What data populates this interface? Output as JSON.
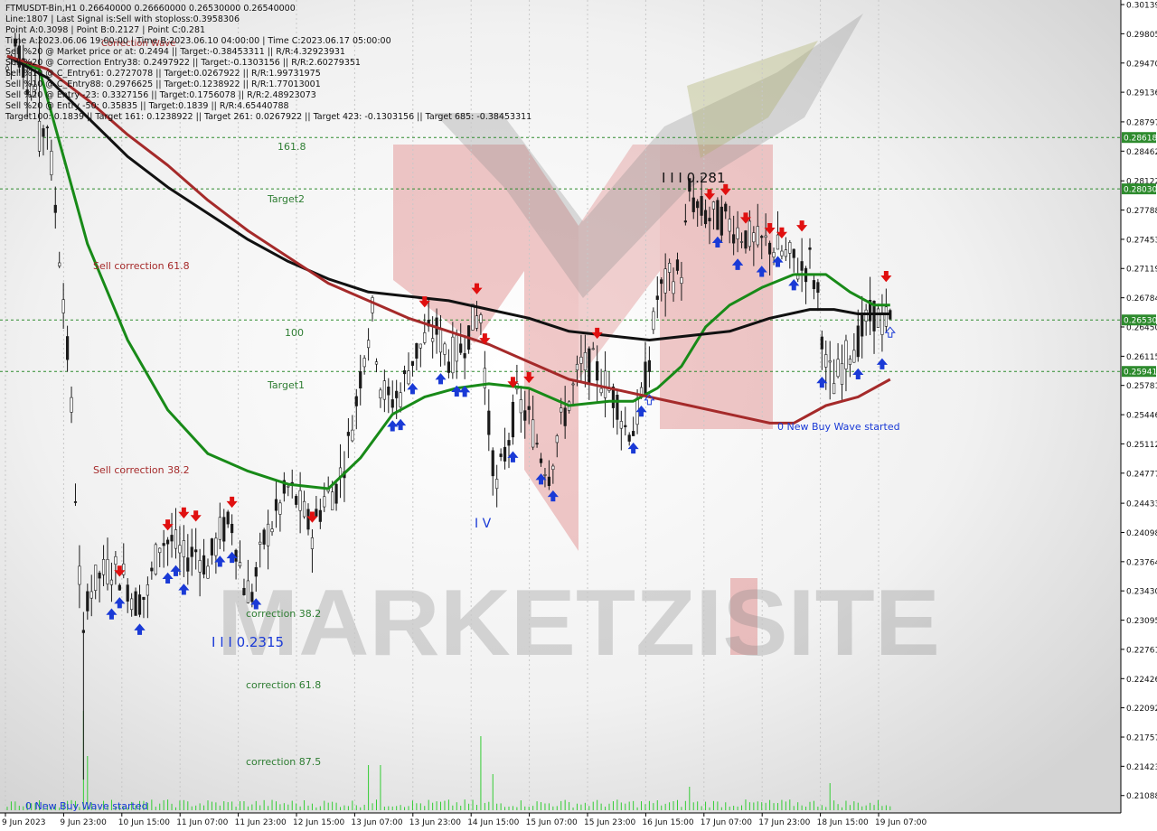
{
  "header": {
    "lines": [
      "FTMUSDT-Bin,H1  0.26640000 0.26660000 0.26530000 0.26540000",
      "Line:1807 | Last Signal is:Sell with stoploss:0.3958306",
      "Point A:0.3098 | Point B:0.2127 | Point C:0.281",
      "Time A:2023.06.06 19:00:00 | Time B:2023.06.10 04:00:00 | Time C:2023.06.17 05:00:00",
      "Sell %20 @ Market price or at: 0.2494 || Target:-0.38453311 || R/R:4.32923931",
      "Sell %20 @ Correction Entry38: 0.2497922 || Target:-0.1303156 || R/R:2.60279351",
      "Sell %10 @ C_Entry61: 0.2727078 || Target:0.0267922 || R/R:1.99731975",
      "Sell %10 @ C_Entry88: 0.2976625 || Target:0.1238922 || R/R:1.77013001",
      "Sell %20 @ Entry -23: 0.3327156 || Target:0.1756078 || R/R:2.48923073",
      "Sell %20 @ Entry -50: 0.35835 || Target:0.1839 || R/R:4.65440788",
      "Target100: 0.1839 || Target 161: 0.1238922 || Target 261: 0.0267922 || Target 423: -0.1303156 || Target 685: -0.38453311"
    ]
  },
  "price_axis": {
    "ticks": [
      "0.30139",
      "0.29805",
      "0.29470",
      "0.29136",
      "0.28797",
      "0.28462",
      "0.28122",
      "0.27788",
      "0.27453",
      "0.27119",
      "0.26784",
      "0.26450",
      "0.26115",
      "0.25781",
      "0.25446",
      "0.25112",
      "0.24777",
      "0.24433",
      "0.24098",
      "0.23764",
      "0.23430",
      "0.23095",
      "0.22761",
      "0.22426",
      "0.22092",
      "0.21757",
      "0.21423",
      "0.21088"
    ],
    "markers": [
      {
        "label": "0.28618",
        "color": "#2e8b2e"
      },
      {
        "label": "0.28030",
        "color": "#2e8b2e"
      },
      {
        "label": "0.26530",
        "color": "#2e8b2e"
      },
      {
        "label": "0.25941",
        "color": "#2e8b2e"
      }
    ]
  },
  "time_axis": {
    "labels": [
      "9 Jun 2023",
      "9 Jun 23:00",
      "10 Jun 15:00",
      "11 Jun 07:00",
      "11 Jun 23:00",
      "12 Jun 15:00",
      "13 Jun 07:00",
      "13 Jun 23:00",
      "14 Jun 15:00",
      "15 Jun 07:00",
      "15 Jun 23:00",
      "16 Jun 15:00",
      "17 Jun 07:00",
      "17 Jun 23:00",
      "18 Jun 15:00",
      "19 Jun 07:00"
    ]
  },
  "levels": [
    {
      "label": "161.8",
      "color": "#2e7d32"
    },
    {
      "label": "Target2",
      "color": "#2e7d32"
    },
    {
      "label": "100",
      "color": "#2e7d32"
    },
    {
      "label": "Target1",
      "color": "#2e7d32"
    }
  ],
  "annotations": {
    "sell_correction_618": "Sell correction 61.8",
    "sell_correction_382": "Sell correction 38.2",
    "correction_382": "correction 38.2",
    "correction_618": "correction 61.8",
    "correction_875": "correction 87.5",
    "wave_low": "I I I 0.2315",
    "wave_high": "I I I 0.281",
    "wave_iv": "I V",
    "new_buy_wave_1": "0 New Buy Wave started",
    "new_buy_wave_2": "0 New Buy Wave started",
    "correction_overlay": "Correction Wave"
  },
  "watermark": {
    "text": "MARKETZISITE"
  },
  "colors": {
    "green_ma": "#188a18",
    "black_ma": "#111111",
    "red_ma": "#a52a2a",
    "buy_arrow": "#1a3ad6",
    "sell_arrow": "#e01010",
    "level_line": "#2e8b2e",
    "label_marker_bg": "#2e8b2e"
  },
  "chart_data": {
    "type": "candlestick",
    "symbol": "FTMUSDT-Bin",
    "timeframe": "H1",
    "ohlc_last": {
      "open": 0.2664,
      "high": 0.2666,
      "low": 0.2653,
      "close": 0.2654
    },
    "ylim": [
      0.2092,
      0.3015
    ],
    "x_range": [
      "2023-06-09 07:00",
      "2023-06-19 16:00"
    ],
    "horizontal_levels": [
      0.28618,
      0.2803,
      0.2653,
      0.25941
    ],
    "price_path": [
      [
        0,
        0.294
      ],
      [
        2,
        0.297
      ],
      [
        3,
        0.296
      ],
      [
        5,
        0.293
      ],
      [
        7,
        0.292
      ],
      [
        8,
        0.286
      ],
      [
        10,
        0.288
      ],
      [
        12,
        0.278
      ],
      [
        14,
        0.268
      ],
      [
        16,
        0.255
      ],
      [
        18,
        0.236
      ],
      [
        19,
        0.228
      ],
      [
        20,
        0.234
      ],
      [
        23,
        0.236
      ],
      [
        26,
        0.237
      ],
      [
        29,
        0.236
      ],
      [
        32,
        0.233
      ],
      [
        35,
        0.234
      ],
      [
        38,
        0.24
      ],
      [
        41,
        0.24
      ],
      [
        44,
        0.238
      ],
      [
        47,
        0.239
      ],
      [
        50,
        0.237
      ],
      [
        53,
        0.241
      ],
      [
        56,
        0.242
      ],
      [
        59,
        0.235
      ],
      [
        61,
        0.234
      ],
      [
        64,
        0.24
      ],
      [
        67,
        0.243
      ],
      [
        70,
        0.246
      ],
      [
        73,
        0.244
      ],
      [
        76,
        0.241
      ],
      [
        79,
        0.245
      ],
      [
        82,
        0.246
      ],
      [
        85,
        0.251
      ],
      [
        87,
        0.256
      ],
      [
        89,
        0.262
      ],
      [
        91,
        0.266
      ],
      [
        93,
        0.258
      ],
      [
        95,
        0.256
      ],
      [
        98,
        0.257
      ],
      [
        101,
        0.261
      ],
      [
        104,
        0.263
      ],
      [
        107,
        0.264
      ],
      [
        110,
        0.261
      ],
      [
        113,
        0.262
      ],
      [
        116,
        0.265
      ],
      [
        118,
        0.266
      ],
      [
        120,
        0.253
      ],
      [
        122,
        0.246
      ],
      [
        124,
        0.25
      ],
      [
        127,
        0.256
      ],
      [
        130,
        0.254
      ],
      [
        133,
        0.25
      ],
      [
        135,
        0.248
      ],
      [
        137,
        0.252
      ],
      [
        140,
        0.256
      ],
      [
        143,
        0.26
      ],
      [
        146,
        0.26
      ],
      [
        149,
        0.258
      ],
      [
        152,
        0.256
      ],
      [
        154,
        0.253
      ],
      [
        156,
        0.253
      ],
      [
        158,
        0.256
      ],
      [
        160,
        0.261
      ],
      [
        162,
        0.268
      ],
      [
        165,
        0.27
      ],
      [
        168,
        0.271
      ],
      [
        170,
        0.28
      ],
      [
        172,
        0.278
      ],
      [
        175,
        0.277
      ],
      [
        178,
        0.277
      ],
      [
        181,
        0.276
      ],
      [
        184,
        0.275
      ],
      [
        187,
        0.274
      ],
      [
        190,
        0.274
      ],
      [
        193,
        0.273
      ],
      [
        196,
        0.272
      ],
      [
        198,
        0.271
      ],
      [
        200,
        0.272
      ],
      [
        202,
        0.268
      ],
      [
        204,
        0.26
      ],
      [
        206,
        0.258
      ],
      [
        208,
        0.26
      ],
      [
        210,
        0.262
      ],
      [
        212,
        0.263
      ],
      [
        214,
        0.265
      ],
      [
        216,
        0.266
      ],
      [
        218,
        0.265
      ],
      [
        220,
        0.2654
      ]
    ],
    "series": [
      {
        "name": "",
        "color": "#188a18",
        "values": [
          [
            0,
            0.2955
          ],
          [
            8,
            0.294
          ],
          [
            14,
            0.284
          ],
          [
            20,
            0.274
          ],
          [
            30,
            0.263
          ],
          [
            40,
            0.255
          ],
          [
            50,
            0.25
          ],
          [
            60,
            0.248
          ],
          [
            70,
            0.2465
          ],
          [
            80,
            0.246
          ],
          [
            88,
            0.2495
          ],
          [
            96,
            0.2545
          ],
          [
            104,
            0.2565
          ],
          [
            112,
            0.2575
          ],
          [
            120,
            0.258
          ],
          [
            130,
            0.2575
          ],
          [
            140,
            0.2555
          ],
          [
            150,
            0.256
          ],
          [
            156,
            0.256
          ],
          [
            162,
            0.2575
          ],
          [
            168,
            0.26
          ],
          [
            174,
            0.2645
          ],
          [
            180,
            0.267
          ],
          [
            188,
            0.269
          ],
          [
            196,
            0.2705
          ],
          [
            204,
            0.2705
          ],
          [
            210,
            0.2685
          ],
          [
            216,
            0.267
          ],
          [
            220,
            0.267
          ]
        ]
      },
      {
        "name": "",
        "color": "#111111",
        "values": [
          [
            0,
            0.2955
          ],
          [
            10,
            0.293
          ],
          [
            20,
            0.2885
          ],
          [
            30,
            0.284
          ],
          [
            40,
            0.2805
          ],
          [
            50,
            0.2775
          ],
          [
            60,
            0.2745
          ],
          [
            70,
            0.272
          ],
          [
            80,
            0.27
          ],
          [
            90,
            0.2685
          ],
          [
            100,
            0.268
          ],
          [
            110,
            0.2675
          ],
          [
            120,
            0.2665
          ],
          [
            130,
            0.2655
          ],
          [
            140,
            0.264
          ],
          [
            150,
            0.2635
          ],
          [
            160,
            0.263
          ],
          [
            170,
            0.2635
          ],
          [
            180,
            0.264
          ],
          [
            190,
            0.2655
          ],
          [
            200,
            0.2665
          ],
          [
            206,
            0.2665
          ],
          [
            212,
            0.266
          ],
          [
            220,
            0.266
          ]
        ]
      },
      {
        "name": "",
        "color": "#a52a2a",
        "values": [
          [
            0,
            0.2955
          ],
          [
            10,
            0.294
          ],
          [
            20,
            0.2905
          ],
          [
            30,
            0.2865
          ],
          [
            40,
            0.283
          ],
          [
            50,
            0.279
          ],
          [
            60,
            0.2755
          ],
          [
            70,
            0.2725
          ],
          [
            80,
            0.2695
          ],
          [
            90,
            0.2675
          ],
          [
            100,
            0.2655
          ],
          [
            110,
            0.264
          ],
          [
            120,
            0.2625
          ],
          [
            130,
            0.2605
          ],
          [
            140,
            0.2585
          ],
          [
            150,
            0.2575
          ],
          [
            160,
            0.2565
          ],
          [
            170,
            0.2555
          ],
          [
            180,
            0.2545
          ],
          [
            190,
            0.2535
          ],
          [
            196,
            0.2535
          ],
          [
            204,
            0.2555
          ],
          [
            212,
            0.2565
          ],
          [
            220,
            0.2585
          ]
        ]
      }
    ]
  }
}
